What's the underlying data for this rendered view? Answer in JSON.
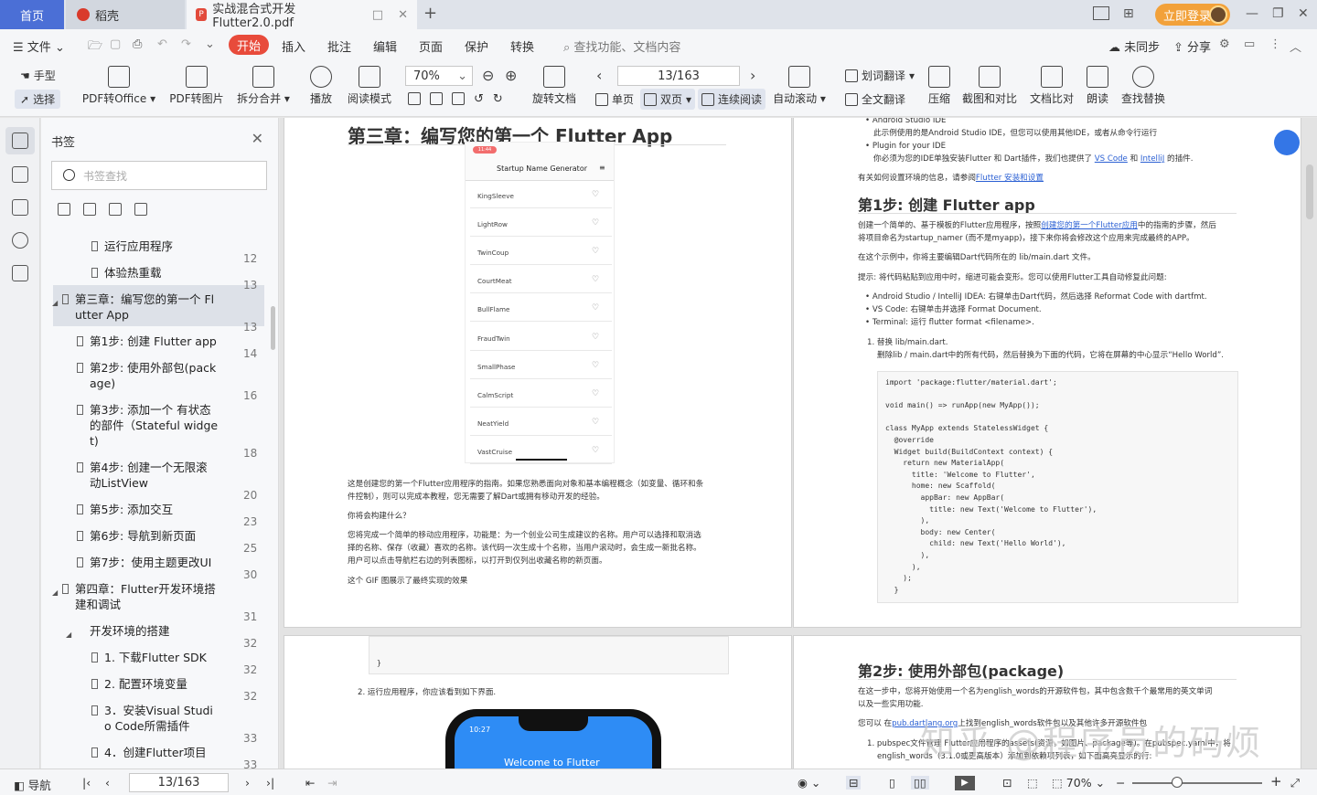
{
  "tabs": {
    "home": "首页",
    "daoke": "稻壳",
    "doc": "实战混合式开发Flutter2.0.pdf"
  },
  "login": "立即登录",
  "menu": {
    "file": "文件",
    "start": "开始",
    "insert": "插入",
    "annotate": "批注",
    "edit": "编辑",
    "page": "页面",
    "protect": "保护",
    "convert": "转换",
    "search_placeholder": "查找功能、文档内容",
    "unsynced": "未同步",
    "share": "分享"
  },
  "ribbon": {
    "hand": "手型",
    "select": "选择",
    "pdf_office": "PDF转Office",
    "pdf_img": "PDF转图片",
    "split": "拆分合并",
    "play": "播放",
    "read_mode": "阅读模式",
    "zoom": "70%",
    "page_input": "13/163",
    "rotate": "旋转文档",
    "single": "单页",
    "double": "双页",
    "continuous": "连续阅读",
    "auto_scroll": "自动滚动",
    "translate_word": "划词翻译",
    "translate_full": "全文翻译",
    "compress": "压缩",
    "screenshot": "截图和对比",
    "compare": "文档比对",
    "read_aloud": "朗读",
    "find_replace": "查找替换"
  },
  "bookmarks": {
    "title": "书签",
    "search_placeholder": "书签查找",
    "items": [
      {
        "label": "运行应用程序",
        "page": "12"
      },
      {
        "label": "体验热重载",
        "page": "13"
      },
      {
        "label": "第三章：编写您的第一个 Fl",
        "label2": "utter App",
        "page": "13"
      },
      {
        "label": "第1步: 创建 Flutter app",
        "page": "14"
      },
      {
        "label": "第2步: 使用外部包(pack",
        "label2": "age)",
        "page": "16"
      },
      {
        "label": "第3步: 添加一个 有状态",
        "label2": "的部件（Stateful widge",
        "label3": "t)",
        "page": "18"
      },
      {
        "label": "第4步: 创建一个无限滚",
        "label2": "动ListView",
        "page": "20"
      },
      {
        "label": "第5步: 添加交互",
        "page": "23"
      },
      {
        "label": "第6步: 导航到新页面",
        "page": "25"
      },
      {
        "label": "第7步：使用主题更改UI",
        "page": "30"
      },
      {
        "label": "第四章：Flutter开发环境搭",
        "label2": "建和调试",
        "page": "31"
      },
      {
        "label": "开发环境的搭建",
        "page": "32"
      },
      {
        "label": "1. 下载Flutter SDK",
        "page": "32"
      },
      {
        "label": "2. 配置环境变量",
        "page": "32"
      },
      {
        "label": "3．安装Visual Studi",
        "label2": "o Code所需插件",
        "page": "33"
      },
      {
        "label": "4．创建Flutter项目",
        "page": "33"
      }
    ]
  },
  "doc_left": {
    "heading": "第三章：编写您的第一个 Flutter App",
    "phone_title": "Startup Name Generator",
    "phone_badge": "11:44",
    "names": [
      "KingSleeve",
      "LightRow",
      "TwinCoup",
      "CourtMeat",
      "BullFlame",
      "FraudTwin",
      "SmallPhase",
      "CalmScript",
      "NeatYield",
      "VastCruise"
    ],
    "para1a": "这是创建您的第一个Flutter应用程序的指南。如果您熟悉面向对象和基本编程概念（如变量、循环和条",
    "para1b": "件控制），则可以完成本教程，您无需要了解Dart或拥有移动开发的经验。",
    "para2": "你将会构建什么？",
    "para3a": "您将完成一个简单的移动应用程序，功能是：为一个创业公司生成建议的名称。用户可以选择和取消选",
    "para3b": "择的名称、保存（收藏）喜欢的名称。该代码一次生成十个名称，当用户滚动时，会生成一新批名称。",
    "para3c": "用户可以点击导航栏右边的列表图标，以打开到仅列出收藏名称的新页面。",
    "para4": "这个 GIF 图展示了最终实现的效果",
    "code_end": "}",
    "step2_run": "2. 运行应用程序，你应该看到如下界面.",
    "phone2_time": "10:27",
    "phone2_title": "Welcome to Flutter"
  },
  "doc_right": {
    "b1": "Android Studio IDE",
    "b1d": "此示例使用的是Android Studio IDE，但您可以使用其他IDE，或者从命令行运行",
    "b2": "Plugin for your IDE",
    "b2d_pre": "你必须为您的IDE单独安装Flutter 和 Dart插件，我们也提供了 ",
    "b2d_link1": "VS Code",
    "b2d_mid": " 和 ",
    "b2d_link2": "IntelliJ",
    "b2d_post": " 的插件.",
    "env_pre": "有关如何设置环境的信息，请参阅",
    "env_link": "Flutter 安装和设置",
    "step1": "第1步: 创建 Flutter app",
    "s1a_pre": "创建一个简单的、基于模板的Flutter应用程序，按照",
    "s1a_link": "创建您的第一个Flutter应用",
    "s1a_post": "中的指南的步骤，然后",
    "s1b": "将项目命名为startup_namer (而不是myapp)，接下来你将会修改这个应用来完成最终的APP。",
    "s1c": "在这个示例中，你将主要编辑Dart代码所在的 lib/main.dart 文件。",
    "s1d": "提示: 将代码粘贴到应用中时，缩进可能会变形。您可以使用Flutter工具自动修复此问题:",
    "li1": "Android Studio / IntelliJ IDEA: 右键单击Dart代码，然后选择 Reformat Code with dartfmt.",
    "li2": "VS Code: 右键单击并选择 Format Document.",
    "li3": "Terminal: 运行 flutter format <filename>.",
    "n1": "1. 替换 lib/main.dart.",
    "n1d": "删除lib / main.dart中的所有代码，然后替换为下面的代码，它将在屏幕的中心显示“Hello World”.",
    "code": [
      "import 'package:flutter/material.dart';",
      "",
      "void main() => runApp(new MyApp());",
      "",
      "class MyApp extends StatelessWidget {",
      "  @override",
      "  Widget build(BuildContext context) {",
      "    return new MaterialApp(",
      "      title: 'Welcome to Flutter',",
      "      home: new Scaffold(",
      "        appBar: new AppBar(",
      "          title: new Text('Welcome to Flutter'),",
      "        ),",
      "        body: new Center(",
      "          child: new Text('Hello World'),",
      "        ),",
      "      ),",
      "    );",
      "  }"
    ],
    "step2": "第2步: 使用外部包(package)",
    "s2a": "在这一步中，您将开始使用一个名为english_words的开源软件包，其中包含数千个最常用的英文单词",
    "s2b": "以及一些实用功能.",
    "s2c_pre": "您可以 在",
    "s2c_link": "pub.dartlang.org",
    "s2c_post": "上找到english_words软件包以及其他许多开源软件包",
    "s2d": "1. pubspec文件管理 Flutter应用程序的assets(资源，如图片、package等)。在pubspec.yaml中，将",
    "s2e": "english_words（3.1.0或更高版本）添加到依赖项列表，如下面高亮显示的行:"
  },
  "watermark": "知乎 @程序员的码烦",
  "status": {
    "nav": "导航",
    "page": "13/163",
    "zoom": "70%"
  }
}
